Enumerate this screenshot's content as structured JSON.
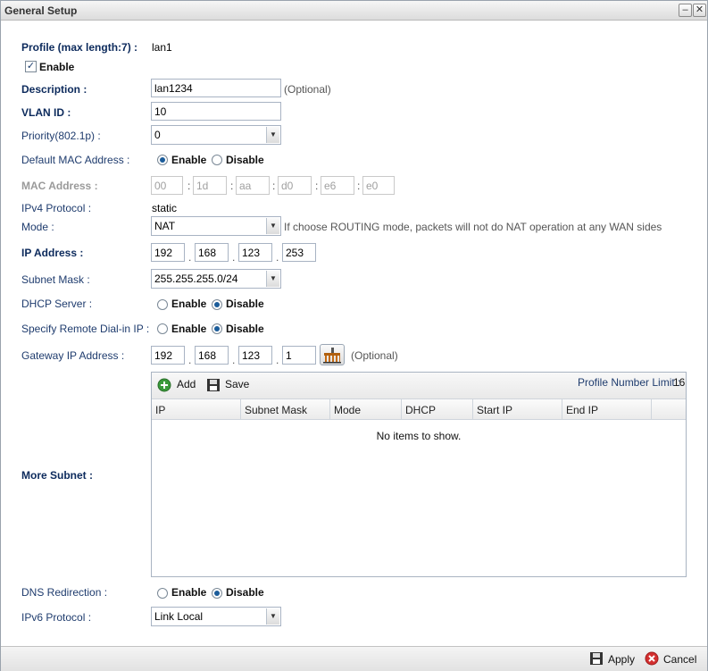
{
  "window": {
    "title": "General Setup",
    "minimize": "–",
    "close": "✕"
  },
  "profile": {
    "label": "Profile (max length:7) :",
    "value": "lan1"
  },
  "enable_checkbox": {
    "label": "Enable",
    "checked": true,
    "mark": "✓"
  },
  "description": {
    "label": "Description :",
    "value": "lan1234",
    "hint": "(Optional)"
  },
  "vlan": {
    "label": "VLAN ID :",
    "value": "10"
  },
  "priority": {
    "label": "Priority(802.1p) :",
    "value": "0"
  },
  "default_mac": {
    "label": "Default MAC Address :",
    "enable": "Enable",
    "disable": "Disable",
    "selected": "Enable"
  },
  "mac": {
    "label": "MAC Address :",
    "octets": [
      "00",
      "1d",
      "aa",
      "d0",
      "e6",
      "e0"
    ],
    "sep": ":"
  },
  "ipv4_protocol": {
    "label": "IPv4 Protocol :",
    "value": "static"
  },
  "mode": {
    "label": "Mode :",
    "value": "NAT",
    "hint": "If choose ROUTING mode, packets will not do NAT operation at any WAN sides"
  },
  "ip_address": {
    "label": "IP Address :",
    "octets": [
      "192",
      "168",
      "123",
      "253"
    ],
    "sep": "."
  },
  "subnet_mask": {
    "label": "Subnet Mask :",
    "value": "255.255.255.0/24"
  },
  "dhcp_server": {
    "label": "DHCP Server :",
    "enable": "Enable",
    "disable": "Disable",
    "selected": "Disable"
  },
  "remote_dialin": {
    "label": "Specify Remote Dial-in IP :",
    "enable": "Enable",
    "disable": "Disable",
    "selected": "Disable"
  },
  "gateway": {
    "label": "Gateway IP Address :",
    "octets": [
      "192",
      "168",
      "123",
      "1"
    ],
    "sep": ".",
    "hint": "(Optional)"
  },
  "more_subnet": {
    "label": "More Subnet :",
    "add": "Add",
    "save": "Save",
    "limit_label": "Profile Number Limit :",
    "limit_value": "16",
    "columns": [
      "IP",
      "Subnet Mask",
      "Mode",
      "DHCP",
      "Start IP",
      "End IP"
    ],
    "empty": "No items to show."
  },
  "dns_redirection": {
    "label": "DNS Redirection :",
    "enable": "Enable",
    "disable": "Disable",
    "selected": "Disable"
  },
  "ipv6_protocol": {
    "label": "IPv6 Protocol :",
    "value": "Link Local"
  },
  "footer": {
    "apply": "Apply",
    "cancel": "Cancel"
  },
  "colors": {
    "label": "#1f3c6e",
    "accent": "#1b5c9a",
    "cancel_icon": "#d32f2f"
  }
}
